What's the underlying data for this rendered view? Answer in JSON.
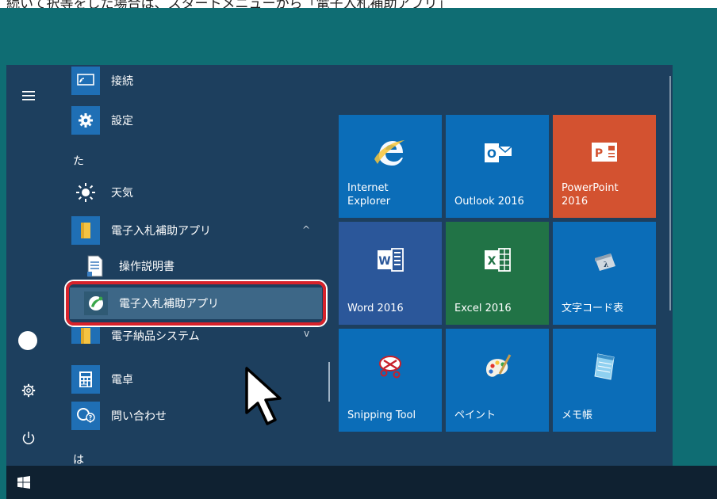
{
  "document": {
    "clipped_text": "続いて択等をした場合は、スタートメニューから「電子入札補助アプリ」"
  },
  "rail": {
    "hamburger_icon": "menu-icon",
    "profile_icon": "user-circle-icon",
    "settings_icon": "gear-icon",
    "power_icon": "power-icon"
  },
  "app_list": {
    "rows": [
      {
        "label": "接続",
        "icon": "connect-icon"
      },
      {
        "label": "設定",
        "icon": "gear-icon"
      },
      {
        "label": "天気",
        "icon": "sun-icon"
      },
      {
        "label": "電子入札補助アプリ",
        "icon": "folder-icon",
        "chevron": "^"
      },
      {
        "label": "操作説明書",
        "icon": "document-icon"
      },
      {
        "label": "電子入札補助アプリ",
        "icon": "app-logo-icon"
      },
      {
        "label": "電子納品システム",
        "icon": "folder-icon",
        "chevron": "v"
      },
      {
        "label": "電卓",
        "icon": "calculator-icon"
      },
      {
        "label": "問い合わせ",
        "icon": "contact-icon"
      }
    ],
    "letters": [
      "た",
      "は"
    ]
  },
  "tiles": [
    {
      "label": "Internet\nExplorer",
      "color": "#0b6db8",
      "icon": "ie-icon"
    },
    {
      "label": "Outlook 2016",
      "color": "#0b6db8",
      "icon": "outlook-icon"
    },
    {
      "label": "PowerPoint\n2016",
      "color": "#d35230",
      "icon": "powerpoint-icon"
    },
    {
      "label": "Word 2016",
      "color": "#2b579a",
      "icon": "word-icon"
    },
    {
      "label": "Excel 2016",
      "color": "#217346",
      "icon": "excel-icon"
    },
    {
      "label": "文字コード表",
      "color": "#0b6db8",
      "icon": "charmap-icon"
    },
    {
      "label": "Snipping Tool",
      "color": "#0b6db8",
      "icon": "snipping-icon"
    },
    {
      "label": "ペイント",
      "color": "#0b6db8",
      "icon": "paint-icon"
    },
    {
      "label": "メモ帳",
      "color": "#0b6db8",
      "icon": "notepad-icon"
    }
  ],
  "colors": {
    "highlight_outline": "#d7222b",
    "start_menu_bg": "#1d3f5e"
  }
}
